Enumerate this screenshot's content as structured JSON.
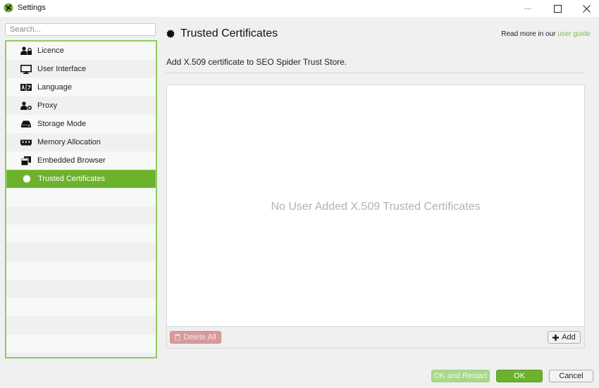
{
  "window": {
    "title": "Settings",
    "icon": "spider-logo-icon",
    "controls": [
      "minimize-icon",
      "maximize-icon",
      "close-icon"
    ]
  },
  "sidebar": {
    "search_placeholder": "Search...",
    "search_value": "",
    "items": [
      {
        "label": "Licence",
        "icon": "user-lock-icon",
        "selected": false
      },
      {
        "label": "User Interface",
        "icon": "monitor-icon",
        "selected": false
      },
      {
        "label": "Language",
        "icon": "language-icon",
        "selected": false
      },
      {
        "label": "Proxy",
        "icon": "user-shield-icon",
        "selected": false
      },
      {
        "label": "Storage Mode",
        "icon": "hard-drive-icon",
        "selected": false
      },
      {
        "label": "Memory Allocation",
        "icon": "memory-chip-icon",
        "selected": false
      },
      {
        "label": "Embedded Browser",
        "icon": "browser-windows-icon",
        "selected": false
      },
      {
        "label": "Trusted Certificates",
        "icon": "certificate-seal-icon",
        "selected": true
      }
    ]
  },
  "panel": {
    "title": "Trusted Certificates",
    "title_icon": "certificate-seal-icon",
    "read_more_prefix": "Read more in our ",
    "read_more_link": "user guide",
    "subtitle": "Add X.509 certificate to SEO Spider Trust Store.",
    "empty_message": "No User Added X.509 Trusted Certificates",
    "delete_all_label": "Delete All",
    "add_label": "Add"
  },
  "footer": {
    "ok_restart_label": "OK and Restart",
    "ok_label": "OK",
    "cancel_label": "Cancel"
  },
  "colors": {
    "accent": "#6cb22d",
    "accent_border": "#8fcd5a",
    "link": "#7ac143",
    "delete_disabled": "#d89a9c",
    "ok_restart_disabled": "#a9d88b"
  }
}
